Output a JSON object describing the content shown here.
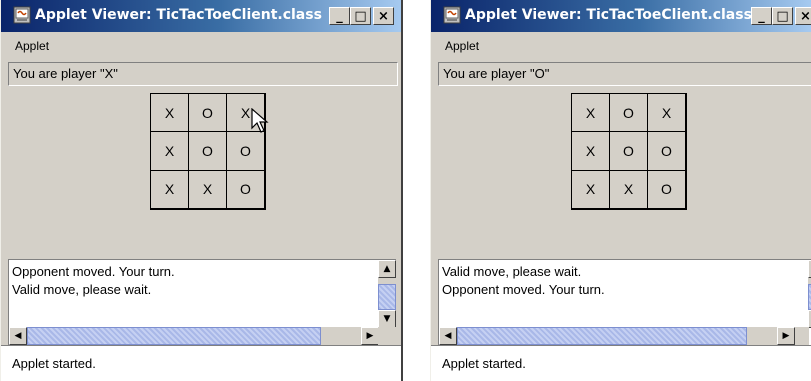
{
  "windows": [
    {
      "title": "Applet Viewer: TicTacToeClient.class",
      "menu": "Applet",
      "player_label": "You are player \"X\"",
      "board": [
        "X",
        "O",
        "X",
        "X",
        "O",
        "O",
        "X",
        "X",
        "O"
      ],
      "log": [
        "Opponent moved. Your turn.",
        "Valid move, please wait."
      ],
      "applet_status": "Applet started.",
      "caption_buttons": {
        "minimize": "_",
        "maximize": "□",
        "close": "×"
      }
    },
    {
      "title": "Applet Viewer: TicTacToeClient.class",
      "menu": "Applet",
      "player_label": "You are player \"O\"",
      "board": [
        "X",
        "O",
        "X",
        "X",
        "O",
        "O",
        "X",
        "X",
        "O"
      ],
      "log": [
        "Valid move, please wait.",
        "Opponent moved. Your turn."
      ],
      "applet_status": "Applet started.",
      "caption_buttons": {
        "minimize": "_",
        "maximize": "□",
        "close": "×"
      }
    }
  ],
  "colors": {
    "titlebar_start": "#0a246a",
    "titlebar_end": "#a6caf0",
    "window_bg": "#d4d0c8",
    "scroll_thumb": "#a9b8e8"
  },
  "icons": {
    "app": "java-coffee-cup-icon",
    "scroll_up": "arrow-up-icon",
    "scroll_down": "arrow-down-icon",
    "scroll_left": "arrow-left-icon",
    "scroll_right": "arrow-right-icon",
    "cursor": "mouse-pointer-icon"
  }
}
